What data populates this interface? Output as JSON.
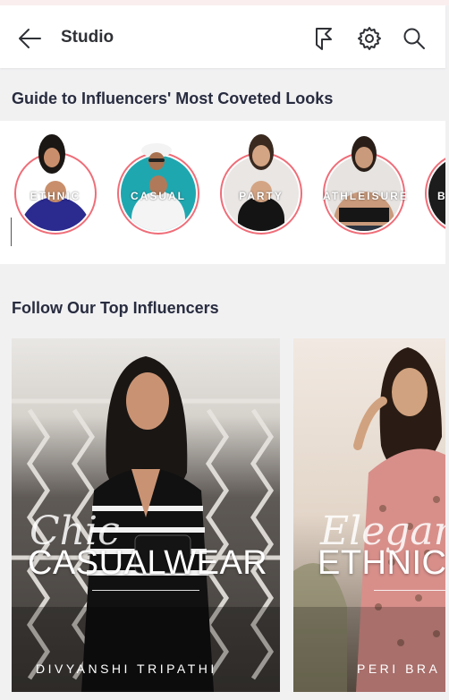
{
  "header": {
    "title": "Studio"
  },
  "guide": {
    "title": "Guide to Influencers' Most Coveted Looks",
    "looks": [
      {
        "label": "ETHNIC"
      },
      {
        "label": "CASUAL"
      },
      {
        "label": "PARTY"
      },
      {
        "label": "ATHLEISURE"
      },
      {
        "label": "B"
      }
    ]
  },
  "influencers": {
    "title": "Follow Our Top Influencers",
    "cards": [
      {
        "script": "Chic",
        "headline": "CASUALWEAR",
        "name": "DIVYANSHI TRIPATHI"
      },
      {
        "script": "Elegant",
        "headline": "ETHNICW",
        "name": "PERI BRA"
      }
    ]
  },
  "colors": {
    "ring": "#ef6d78",
    "header_bg": "#ffffff",
    "page_bg": "#f1f1f2"
  }
}
